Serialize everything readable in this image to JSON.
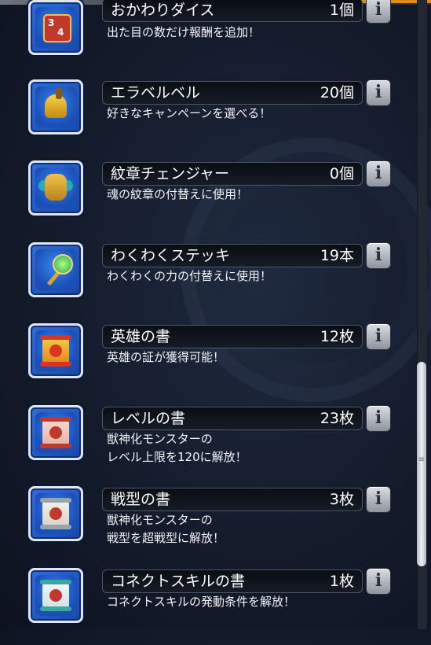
{
  "items": [
    {
      "name": "おかわりダイス",
      "count": "1個",
      "description": "出た目の数だけ報酬を追加！",
      "icon": "dice-icon"
    },
    {
      "name": "エラベルベル",
      "count": "20個",
      "description": "好きなキャンペーンを選べる！",
      "icon": "bell-icon"
    },
    {
      "name": "紋章チェンジャー",
      "count": "0個",
      "description": "魂の紋章の付替えに使用！",
      "icon": "emblem-changer-icon"
    },
    {
      "name": "わくわくステッキ",
      "count": "19本",
      "description": "わくわくの力の付替えに使用！",
      "icon": "wand-icon"
    },
    {
      "name": "英雄の書",
      "count": "12枚",
      "description": "英雄の証が獲得可能！",
      "icon": "hero-book-icon"
    },
    {
      "name": "レベルの書",
      "count": "23枚",
      "description": "獣神化モンスターの\nレベル上限を120に解放！",
      "icon": "level-book-icon"
    },
    {
      "name": "戦型の書",
      "count": "3枚",
      "description": "獣神化モンスターの\n戦型を超戦型に解放！",
      "icon": "battle-type-book-icon"
    },
    {
      "name": "コネクトスキルの書",
      "count": "1枚",
      "description": "コネクトスキルの発動条件を解放！",
      "icon": "connect-skill-book-icon"
    }
  ],
  "info_glyph": "i",
  "colors": {
    "icon_frame": "#2f6dd8",
    "name_bar": "#0a0d14",
    "text": "#ffffff",
    "scroll_thumb": "#eef1f5"
  }
}
